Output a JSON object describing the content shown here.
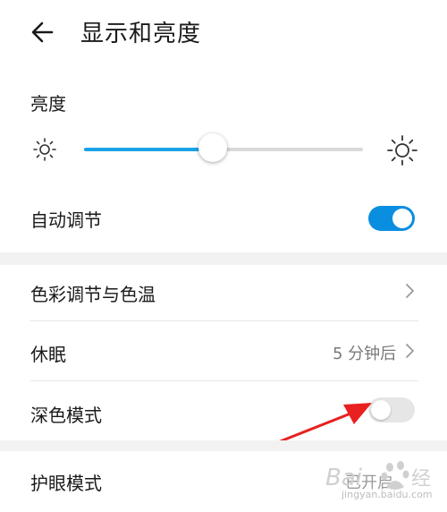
{
  "header": {
    "title": "显示和亮度",
    "back_icon": "back-arrow-icon"
  },
  "brightness": {
    "label": "亮度",
    "level": 0.46,
    "accent_color": "#1aa3e6"
  },
  "auto_adjust": {
    "label": "自动调节",
    "enabled": true,
    "color": "#0a8ee0"
  },
  "rows": {
    "color_temp": {
      "label": "色彩调节与色温"
    },
    "sleep": {
      "label": "休眠",
      "value": "5 分钟后"
    },
    "dark_mode": {
      "label": "深色模式",
      "enabled": false
    },
    "eye_comfort": {
      "label": "护眼模式",
      "value": "已开启"
    }
  },
  "annotation": {
    "arrow_color": "#e8201f"
  },
  "watermark": {
    "text": "jingyan.baidu.com"
  }
}
